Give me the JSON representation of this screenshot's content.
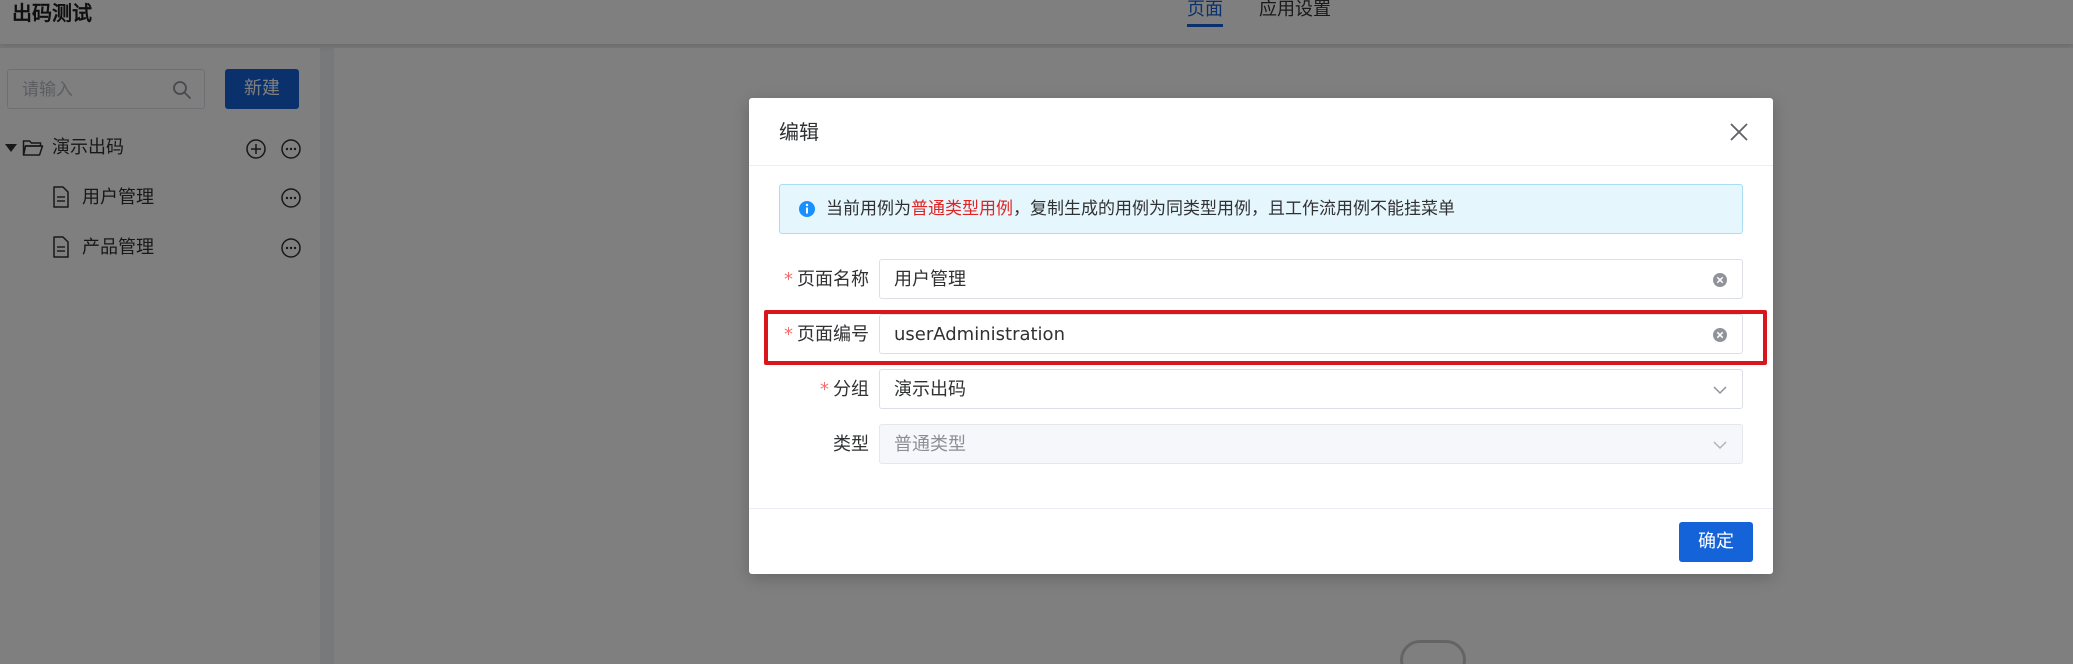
{
  "app": {
    "title": "出码测试"
  },
  "header": {
    "tabs": [
      {
        "label": "页面",
        "active": true
      },
      {
        "label": "应用设置",
        "active": false
      }
    ]
  },
  "sidebar": {
    "search_placeholder": "请输入",
    "new_button": "新建",
    "tree": {
      "root": {
        "label": "演示出码",
        "expanded": true
      },
      "children": [
        {
          "label": "用户管理"
        },
        {
          "label": "产品管理"
        }
      ]
    }
  },
  "dialog": {
    "title": "编辑",
    "alert": {
      "prefix": "当前用例为",
      "highlight": "普通类型用例",
      "suffix": "，复制生成的用例为同类型用例，且工作流用例不能挂菜单"
    },
    "fields": [
      {
        "label": "页面名称",
        "required": true,
        "value": "用户管理"
      },
      {
        "label": "页面编号",
        "required": true,
        "value": "userAdministration"
      },
      {
        "label": "分组",
        "required": true,
        "value": "演示出码"
      },
      {
        "label": "类型",
        "required": false,
        "value": "普通类型",
        "disabled": true
      }
    ],
    "required_mark": "*",
    "confirm_button": "确定"
  },
  "colors": {
    "primary": "#1463d8",
    "highlight_box": "#d9161c",
    "required": "#f56c6c",
    "alert_bg": "#e6f6fd"
  }
}
